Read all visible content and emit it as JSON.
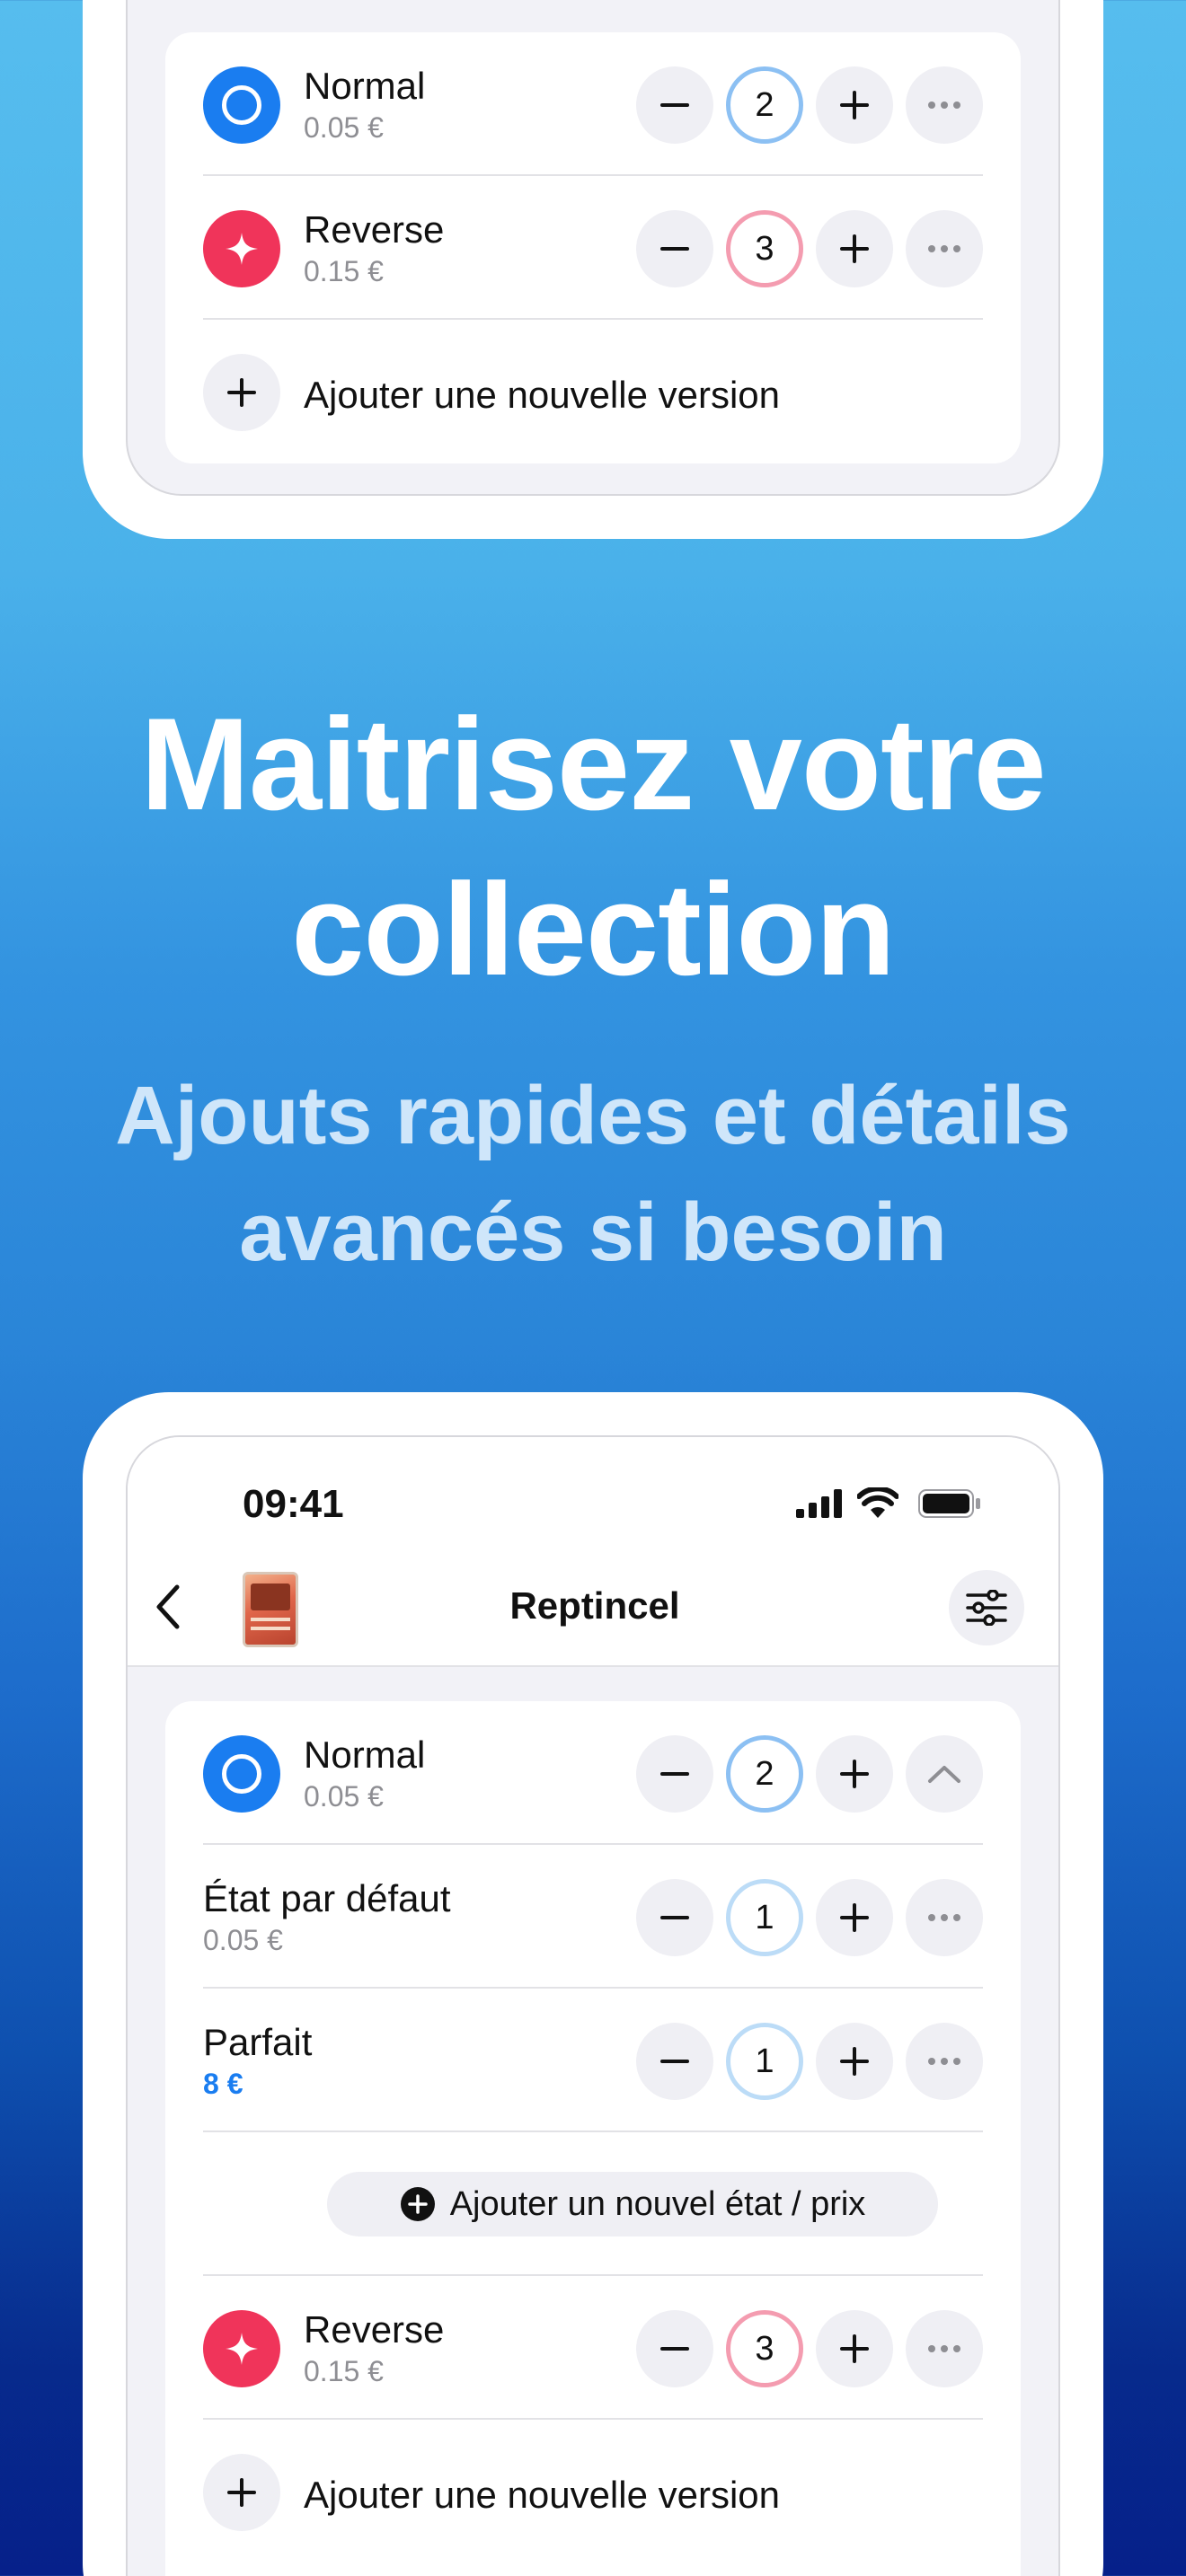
{
  "promo": {
    "headline_line1": "Maitrisez votre",
    "headline_line2": "collection",
    "subline_line1": "Ajouts rapides et détails",
    "subline_line2": "avancés si besoin"
  },
  "top_card": {
    "versions": [
      {
        "title": "Normal",
        "price": "0.05 €",
        "count": "2",
        "badge": "circle-icon",
        "badge_color": "#1a7df0"
      },
      {
        "title": "Reverse",
        "price": "0.15 €",
        "count": "3",
        "badge": "sparkle-icon",
        "badge_color": "#f0345a"
      }
    ],
    "add_version_label": "Ajouter une nouvelle version"
  },
  "status_bar": {
    "time": "09:41",
    "icons": [
      "cellular-signal-icon",
      "wifi-icon",
      "battery-icon"
    ]
  },
  "nav": {
    "title": "Reptincel",
    "back_icon": "chevron-left-icon",
    "filter_icon": "sliders-icon"
  },
  "detail_card": {
    "normal": {
      "title": "Normal",
      "price": "0.05 €",
      "count": "2",
      "toggle_icon": "chevron-up-icon"
    },
    "conditions": [
      {
        "title": "État par défaut",
        "price": "0.05 €",
        "count": "1"
      },
      {
        "title": "Parfait",
        "price": "8 €",
        "count": "1"
      }
    ],
    "add_condition_label": "Ajouter un nouvel état / prix",
    "reverse": {
      "title": "Reverse",
      "price": "0.15 €",
      "count": "3"
    },
    "add_version_label": "Ajouter une nouvelle version"
  },
  "colors": {
    "accent_blue": "#1a7df0",
    "accent_red": "#f0345a",
    "control_bg": "#efeff4",
    "price_highlight": "#1a7df0"
  }
}
